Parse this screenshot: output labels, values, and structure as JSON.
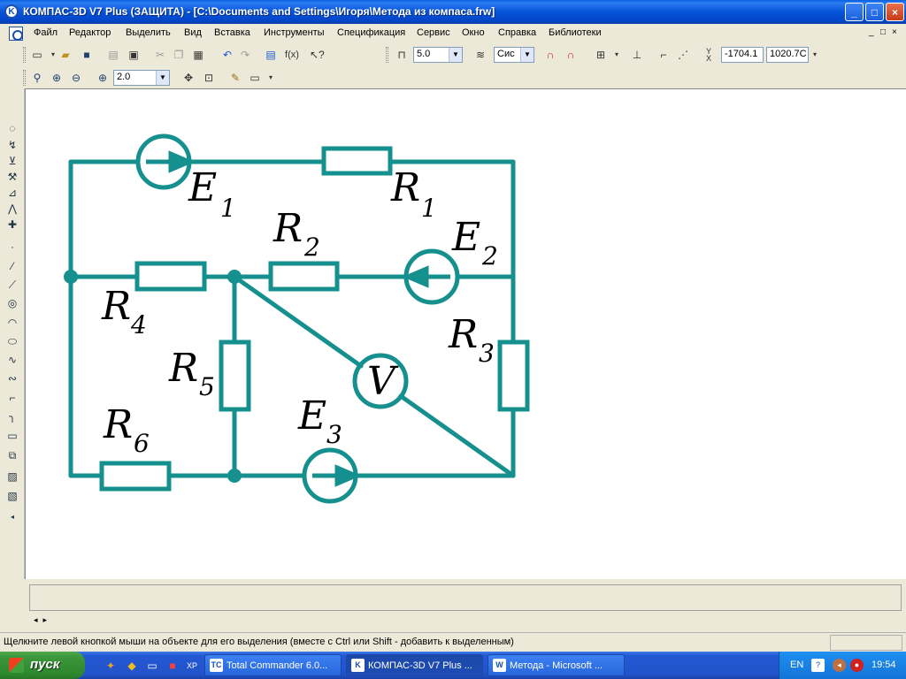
{
  "window": {
    "title": "КОМПАС-3D V7 Plus (ЗАЩИТА) - [C:\\Documents and Settings\\Игоря\\Метода из компаса.frw]",
    "app_icon_letter": "K",
    "minimize": "_",
    "maximize": "□",
    "close": "×"
  },
  "menu": {
    "items": [
      {
        "label": "Файл"
      },
      {
        "label": "Редактор"
      },
      {
        "label": "Выделить"
      },
      {
        "label": "Вид"
      },
      {
        "label": "Вставка"
      },
      {
        "label": "Инструменты"
      },
      {
        "label": "Спецификация"
      },
      {
        "label": "Сервис"
      },
      {
        "label": "Окно"
      },
      {
        "label": "Справка"
      },
      {
        "label": "Библиотеки"
      }
    ],
    "mdi_controls": [
      "_",
      "□",
      "×"
    ]
  },
  "toolbar1": {
    "step_value": "5.0",
    "layer_value": "Сис",
    "coord_x_label": "X",
    "coord_y_label": "Y",
    "coord_x": "-1704.1",
    "coord_y": "1020.7C",
    "fx_label": "f(x)"
  },
  "toolbar2": {
    "zoom_value": "2.0"
  },
  "icons": {
    "new": "new-document-icon",
    "open": "open-folder-icon",
    "save": "save-icon",
    "print": "print-icon",
    "preview": "print-preview-icon",
    "cut": "cut-icon",
    "copy": "copy-icon",
    "paste": "paste-icon",
    "undo": "undo-icon",
    "redo": "redo-icon",
    "help": "help-pointer-icon",
    "zoom_window": "zoom-window-icon",
    "zoom_in": "zoom-in-icon",
    "zoom_out": "zoom-out-icon",
    "pan": "pan-icon",
    "fit": "zoom-fit-icon"
  },
  "circuit": {
    "labels": [
      {
        "text": "E",
        "sub": "1"
      },
      {
        "text": "R",
        "sub": "1"
      },
      {
        "text": "R",
        "sub": "2"
      },
      {
        "text": "E",
        "sub": "2"
      },
      {
        "text": "R",
        "sub": "4"
      },
      {
        "text": "R",
        "sub": "3"
      },
      {
        "text": "R",
        "sub": "5"
      },
      {
        "text": "V",
        "sub": ""
      },
      {
        "text": "E",
        "sub": "3"
      },
      {
        "text": "R",
        "sub": "6"
      }
    ],
    "wire_color": "#15908e"
  },
  "status": {
    "text": "Щелкните левой кнопкой мыши на объекте для его выделения (вместе с Ctrl или Shift - добавить к выделенным)"
  },
  "taskbar": {
    "start_label": "пуск",
    "tasks": [
      {
        "label": "Total Commander 6.0...",
        "icon": "TC"
      },
      {
        "label": "КОМПАС-3D V7 Plus ...",
        "icon": "K"
      },
      {
        "label": "Метода - Microsoft ...",
        "icon": "W"
      }
    ],
    "lang": "EN",
    "clock": "19:54"
  }
}
